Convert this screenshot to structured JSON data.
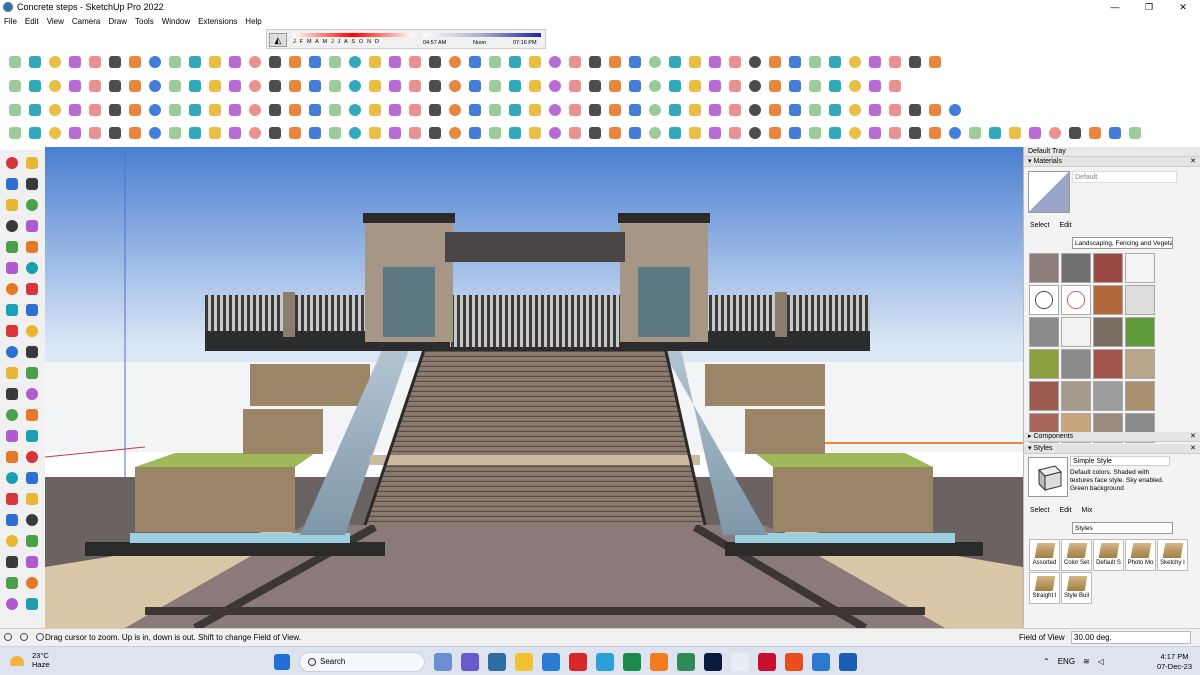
{
  "window": {
    "title": "Concrete steps - SketchUp Pro 2022",
    "minimize": "—",
    "maximize": "❐",
    "close": "✕"
  },
  "menu": [
    "File",
    "Edit",
    "View",
    "Camera",
    "Draw",
    "Tools",
    "Window",
    "Extensions",
    "Help"
  ],
  "shadow_settings": {
    "months": "J F M A M J J A S O N D",
    "time_start": "04:57 AM",
    "time_noon": "Noon",
    "time_end": "07:16 PM"
  },
  "tray": {
    "title": "Default Tray",
    "materials": {
      "header": "Materials",
      "current_name": "Default",
      "tabs": [
        "Select",
        "Edit"
      ],
      "library": "Landscaping, Fencing and Vegetation"
    },
    "components": {
      "header": "Components"
    },
    "styles": {
      "header": "Styles",
      "current_name": "Simple Style",
      "description": "Default colors. Shaded with textures face style. Sky enabled. Green background",
      "tabs": [
        "Select",
        "Edit",
        "Mix"
      ],
      "library": "Styles",
      "collections": [
        "Assorted",
        "Color Set",
        "Default S",
        "Photo Mo",
        "Sketchy I",
        "Straight I",
        "Style Buil"
      ]
    }
  },
  "status": {
    "message": "Drag cursor to zoom.  Up is in, down is out. Shift to change Field of View.",
    "fov_label": "Field of View",
    "fov_value": "30.00 deg."
  },
  "taskbar": {
    "temperature": "23°C",
    "condition": "Haze",
    "search_placeholder": "Search",
    "language": "ENG",
    "time": "4:17 PM",
    "date": "07-Dec-23"
  },
  "colors": {
    "sky_top": "#4a7fd0",
    "sky_bottom": "#f2f5fa",
    "ground": "#6a6262",
    "grass": "#a7b75a"
  }
}
